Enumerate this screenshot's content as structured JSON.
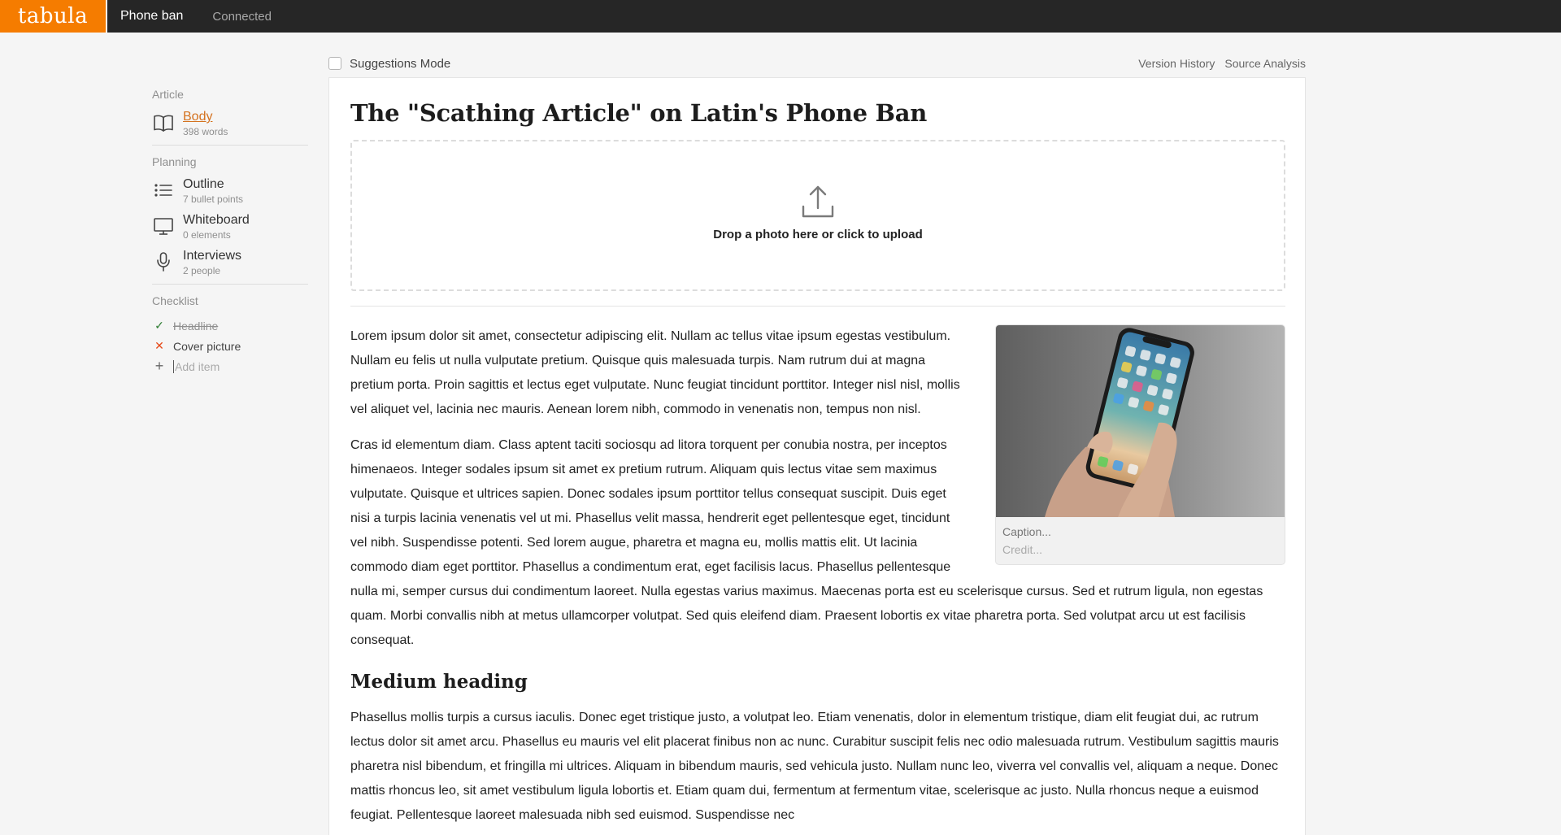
{
  "topbar": {
    "logo": "tabula",
    "doc_title": "Phone ban",
    "status": "Connected"
  },
  "sidebar": {
    "article_label": "Article",
    "article_items": [
      {
        "title": "Body",
        "sub": "398 words",
        "icon": "book-icon",
        "active": true
      }
    ],
    "planning_label": "Planning",
    "planning_items": [
      {
        "title": "Outline",
        "sub": "7 bullet points",
        "icon": "list-icon"
      },
      {
        "title": "Whiteboard",
        "sub": "0 elements",
        "icon": "monitor-icon"
      },
      {
        "title": "Interviews",
        "sub": "2 people",
        "icon": "microphone-icon"
      }
    ],
    "checklist_label": "Checklist",
    "checklist": [
      {
        "label": "Headline",
        "state": "done"
      },
      {
        "label": "Cover picture",
        "state": "missing"
      }
    ],
    "add_item_placeholder": "Add item"
  },
  "toolbar": {
    "suggestions_mode": "Suggestions Mode",
    "version_history": "Version History",
    "source_analysis": "Source Analysis"
  },
  "document": {
    "title": "The \"Scathing Article\" on Latin's Phone Ban",
    "upload_text": "Drop a photo here or click to upload",
    "figure": {
      "caption_placeholder": "Caption...",
      "credit_placeholder": "Credit..."
    },
    "paragraphs": [
      "Lorem ipsum dolor sit amet, consectetur adipiscing elit. Nullam ac tellus vitae ipsum egestas vestibulum. Nullam eu felis ut nulla vulputate pretium. Quisque quis malesuada turpis. Nam rutrum dui at magna pretium porta. Proin sagittis et lectus eget vulputate. Nunc feugiat tincidunt porttitor. Integer nisl nisl, mollis vel aliquet vel, lacinia nec mauris. Aenean lorem nibh, commodo in venenatis non, tempus non nisl.",
      "Cras id elementum diam. Class aptent taciti sociosqu ad litora torquent per conubia nostra, per inceptos himenaeos. Integer sodales ipsum sit amet ex pretium rutrum. Aliquam quis lectus vitae sem maximus vulputate. Quisque et ultrices sapien. Donec sodales ipsum porttitor tellus consequat suscipit. Duis eget nisi a turpis lacinia venenatis vel ut mi. Phasellus velit massa, hendrerit eget pellentesque eget, tincidunt vel nibh. Suspendisse potenti. Sed lorem augue, pharetra et magna eu, mollis mattis elit. Ut lacinia commodo diam eget porttitor. Phasellus a condimentum erat, eget facilisis lacus. Phasellus pellentesque nulla mi, semper cursus dui condimentum laoreet. Nulla egestas varius maximus. Maecenas porta est eu scelerisque cursus. Sed et rutrum ligula, non egestas quam. Morbi convallis nibh at metus ullamcorper volutpat. Sed quis eleifend diam. Praesent lobortis ex vitae pharetra porta. Sed volutpat arcu ut est facilisis consequat."
    ],
    "medium_heading": "Medium heading",
    "paragraph_after_heading": "Phasellus mollis turpis a cursus iaculis. Donec eget tristique justo, a volutpat leo. Etiam venenatis, dolor in elementum tristique, diam elit feugiat dui, ac rutrum lectus dolor sit amet arcu. Phasellus eu mauris vel elit placerat finibus non ac nunc. Curabitur suscipit felis nec odio malesuada rutrum. Vestibulum sagittis mauris pharetra nisl bibendum, et fringilla mi ultrices. Aliquam in bibendum mauris, sed vehicula justo. Nullam nunc leo, viverra vel convallis vel, aliquam a neque. Donec mattis rhoncus leo, sit amet vestibulum ligula lobortis et. Etiam quam dui, fermentum at fermentum vitae, scelerisque ac justo. Nulla rhoncus neque a euismod feugiat. Pellentesque laoreet malesuada nibh sed euismod. Suspendisse nec"
  },
  "colors": {
    "brand_orange": "#f57c00",
    "topbar_bg": "#262626",
    "active_link": "#d4721f",
    "check_green": "#2e7d32",
    "check_red": "#e64a19"
  }
}
